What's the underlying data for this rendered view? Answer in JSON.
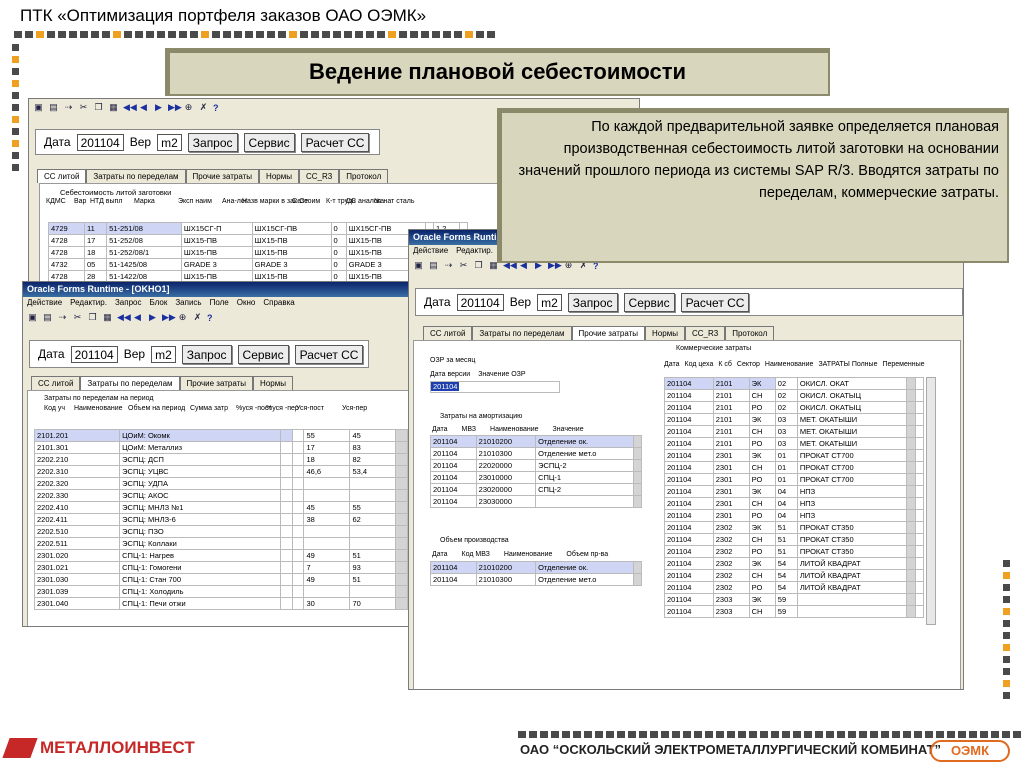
{
  "title": "ПТК «Оптимизация портфеля заказов ОАО ОЭМК»",
  "banner": "Ведение плановой себестоимости",
  "callout": "По каждой предварительной заявке определяется  плановая производственная себестоимость литой заготовки на основании значений прошлого периода из системы SAP R/3. Вводятся затраты по переделам, коммерческие затраты.",
  "footer": {
    "left_logo": "МЕТАЛЛОИНВЕСТ",
    "right_text": "ОАО “ОСКОЛЬСКИЙ ЭЛЕКТРОМЕТАЛЛУРГИЧЕСКИЙ КОМБИНАТ”",
    "right_logo": "ОЭМК"
  },
  "form": {
    "date_label": "Дата",
    "date_value": "201104",
    "ver_label": "Вер",
    "ver_value": "m2",
    "btn_query": "Запрос",
    "btn_service": "Сервис",
    "btn_calc": "Расчет СС"
  },
  "window_caption": "Oracle Forms Runtime - [OKHO1]",
  "window_caption2": "Oracle Forms Runtime - [OKHO1]",
  "menu": [
    "Действие",
    "Редактир.",
    "Запрос",
    "Блок",
    "Запись",
    "Поле",
    "Окно",
    "Справка"
  ],
  "toolbar_help": "?",
  "tabs_back": [
    "СС литой",
    "Затраты по переделам",
    "Прочие затраты",
    "Нормы",
    "СС_R3",
    "Протокол"
  ],
  "tabs_mid": [
    "СС литой",
    "Затраты по переделам",
    "Прочие затраты",
    "Нормы"
  ],
  "tabs_right": [
    "СС литой",
    "Затраты по переделам",
    "Прочие затраты",
    "Нормы",
    "СС_R3",
    "Протокол"
  ],
  "back_window": {
    "group": "Себестоимость литой заготовки",
    "headers": [
      "КДМС",
      "Вар",
      "НТД выпл",
      "Марка",
      "Эксп наим",
      "Ана-лог",
      "Назв марки в заказе",
      "С-Стоим",
      "К-т трудн",
      "СС аналога",
      "№ нат сталь"
    ],
    "rows": [
      [
        "4729",
        "11",
        "51-251/08",
        "ШХ15СГ-П",
        "ШХ15СГ-ПВ",
        "0",
        "ШХ15СГ-ПВ",
        "",
        "1,2"
      ],
      [
        "4728",
        "17",
        "51-252/08",
        "ШХ15-ПВ",
        "ШХ15-ПВ",
        "0",
        "ШХ15-ПВ",
        "",
        "1,2"
      ],
      [
        "4728",
        "18",
        "51-252/08/1",
        "ШХ15-ПВ",
        "ШХ15-ПВ",
        "0",
        "ШХ15-ПВ",
        "",
        "1,2"
      ],
      [
        "4732",
        "05",
        "51-1425/08",
        "GRADE 3",
        "GRADE 3",
        "0",
        "GRADE 3",
        "",
        "1,2"
      ],
      [
        "4728",
        "28",
        "51-1422/08",
        "ШХ15-ПВ",
        "ШХ15-ПВ",
        "0",
        "ШХ15-ПВ",
        "",
        "1,2"
      ]
    ]
  },
  "mid_window": {
    "group": "Затраты по переделам на период",
    "headers": [
      "Код уч",
      "Наименование",
      "Объем на период",
      "Сумма затр",
      "%уся -пост",
      "%уся -пер",
      "Уся-пост",
      "Уся-пер"
    ],
    "rows": [
      [
        "2101.201",
        "ЦОиМ: Окомк",
        "",
        "",
        "55",
        "45"
      ],
      [
        "2101.301",
        "ЦОиМ: Металлиз",
        "",
        "",
        "17",
        "83"
      ],
      [
        "2202.210",
        "ЭСПЦ: ДСП",
        "",
        "",
        "18",
        "82"
      ],
      [
        "2202.310",
        "ЭСПЦ: УЦВС",
        "",
        "",
        "46,6",
        "53,4"
      ],
      [
        "2202.320",
        "ЭСПЦ: УДПА",
        "",
        "",
        "",
        ""
      ],
      [
        "2202.330",
        "ЭСПЦ: АКОС",
        "",
        "",
        "",
        ""
      ],
      [
        "2202.410",
        "ЭСПЦ: МНЛЗ №1",
        "",
        "",
        "45",
        "55"
      ],
      [
        "2202.411",
        "ЭСПЦ: МНЛЗ-6",
        "",
        "",
        "38",
        "62"
      ],
      [
        "2202.510",
        "ЭСПЦ: ПЗО",
        "",
        "",
        "",
        ""
      ],
      [
        "2202.511",
        "ЭСПЦ: Коллаки",
        "",
        "",
        "",
        ""
      ],
      [
        "2301.020",
        "СПЦ-1: Нагрев",
        "",
        "",
        "49",
        "51"
      ],
      [
        "2301.021",
        "СПЦ-1: Гомогени",
        "",
        "",
        "7",
        "93"
      ],
      [
        "2301.030",
        "СПЦ-1: Стан 700",
        "",
        "",
        "49",
        "51"
      ],
      [
        "2301.039",
        "СПЦ-1: Холодиль",
        "",
        "",
        "",
        ""
      ],
      [
        "2301.040",
        "СПЦ-1: Печи отжи",
        "",
        "",
        "30",
        "70"
      ]
    ]
  },
  "right_window": {
    "ozr_group": "ОЗР за месяц",
    "ozr_headers": [
      "Дата версии",
      "Значение ОЗР"
    ],
    "ozr_value": "201104",
    "amort_group": "Затраты на амортизацию",
    "amort_headers": [
      "Дата",
      "МВЗ",
      "Наименование",
      "Значение"
    ],
    "amort_rows": [
      [
        "201104",
        "21010200",
        "Отделение ок."
      ],
      [
        "201104",
        "21010300",
        "Отделение мет.о"
      ],
      [
        "201104",
        "22020000",
        "ЭСПЦ-2"
      ],
      [
        "201104",
        "23010000",
        "СПЦ-1"
      ],
      [
        "201104",
        "23020000",
        "СПЦ-2"
      ],
      [
        "201104",
        "23030000",
        ""
      ]
    ],
    "vol_group": "Объем производства",
    "vol_headers": [
      "Дата",
      "Код МВЗ",
      "Наименование",
      "Объем пр-ва"
    ],
    "vol_rows": [
      [
        "201104",
        "21010200",
        "Отделение ок."
      ],
      [
        "201104",
        "21010300",
        "Отделение мет.о"
      ]
    ],
    "comm_group": "Коммерческие затраты",
    "comm_headers": [
      "Дата",
      "Код цеха",
      "К сб",
      "Сектор",
      "Наименование",
      "ЗАТРАТЫ Полные",
      "Переменные"
    ],
    "comm_rows": [
      [
        "201104",
        "2101",
        "ЭК",
        "02",
        "ОКИСЛ. ОКАТ"
      ],
      [
        "201104",
        "2101",
        "СН",
        "02",
        "ОКИСЛ. ОКАТЫЦ"
      ],
      [
        "201104",
        "2101",
        "РО",
        "02",
        "ОКИСЛ. ОКАТЫЦ"
      ],
      [
        "201104",
        "2101",
        "ЭК",
        "03",
        "МЕТ. ОКАТЫШИ"
      ],
      [
        "201104",
        "2101",
        "СН",
        "03",
        "МЕТ. ОКАТЫШИ"
      ],
      [
        "201104",
        "2101",
        "РО",
        "03",
        "МЕТ. ОКАТЫШИ"
      ],
      [
        "201104",
        "2301",
        "ЭК",
        "01",
        "ПРОКАТ СТ700"
      ],
      [
        "201104",
        "2301",
        "СН",
        "01",
        "ПРОКАТ СТ700"
      ],
      [
        "201104",
        "2301",
        "РО",
        "01",
        "ПРОКАТ СТ700"
      ],
      [
        "201104",
        "2301",
        "ЭК",
        "04",
        "НПЗ"
      ],
      [
        "201104",
        "2301",
        "СН",
        "04",
        "НПЗ"
      ],
      [
        "201104",
        "2301",
        "РО",
        "04",
        "НПЗ"
      ],
      [
        "201104",
        "2302",
        "ЭК",
        "51",
        "ПРОКАТ СТ350"
      ],
      [
        "201104",
        "2302",
        "СН",
        "51",
        "ПРОКАТ СТ350"
      ],
      [
        "201104",
        "2302",
        "РО",
        "51",
        "ПРОКАТ СТ350"
      ],
      [
        "201104",
        "2302",
        "ЭК",
        "54",
        "ЛИТОЙ КВАДРАТ"
      ],
      [
        "201104",
        "2302",
        "СН",
        "54",
        "ЛИТОЙ КВАДРАТ"
      ],
      [
        "201104",
        "2302",
        "РО",
        "54",
        "ЛИТОЙ КВАДРАТ"
      ],
      [
        "201104",
        "2303",
        "ЭК",
        "59",
        ""
      ],
      [
        "201104",
        "2303",
        "СН",
        "59",
        ""
      ]
    ]
  },
  "colors": {
    "banner_bg": "#d8d6bc",
    "accent_orange": "#f0a020",
    "brand_red": "#c62828",
    "omk_orange": "#e06a20"
  }
}
